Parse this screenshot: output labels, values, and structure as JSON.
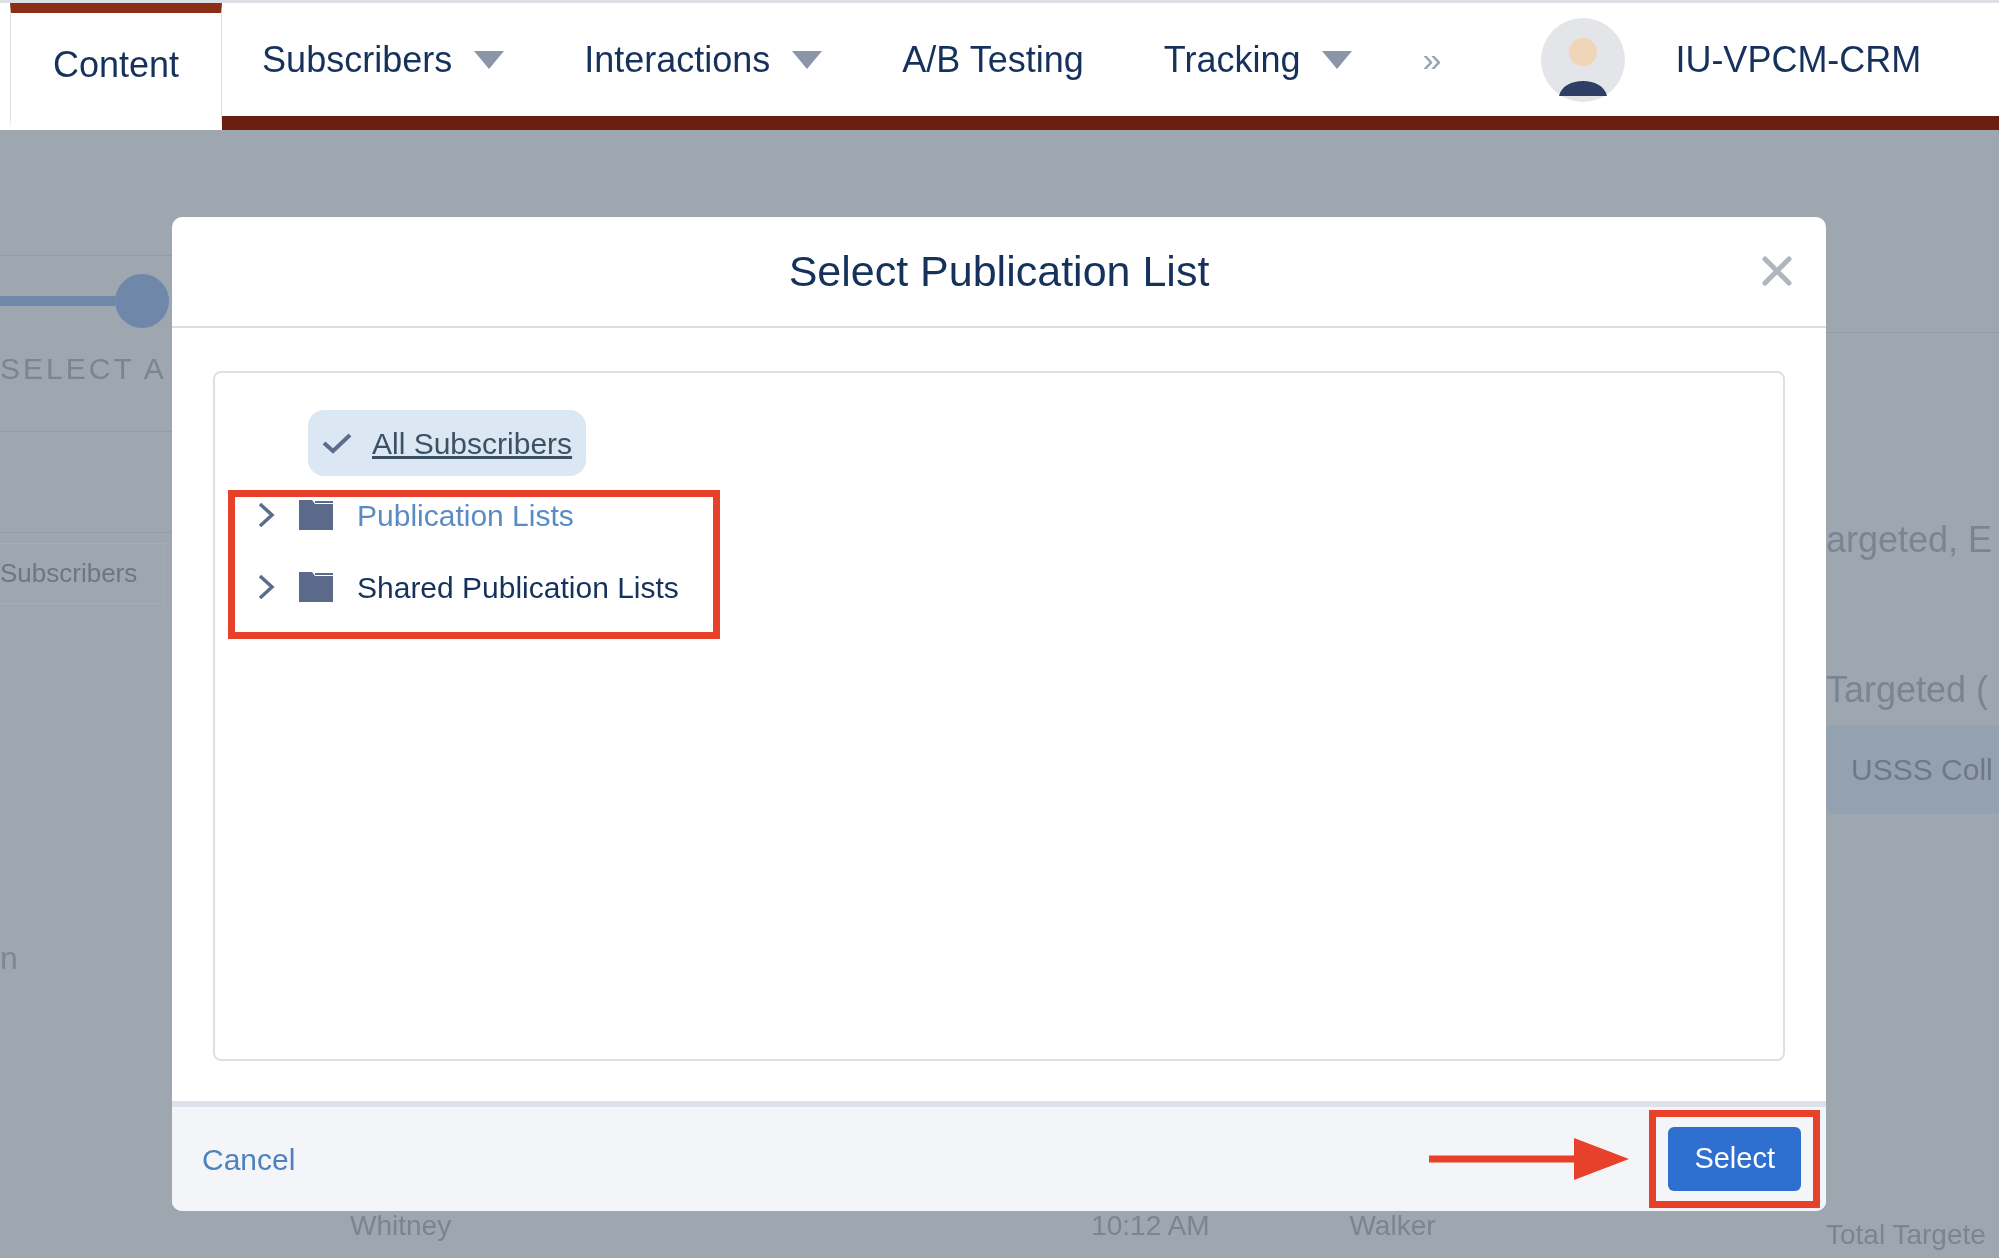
{
  "nav": {
    "tabs": [
      {
        "label": "Content",
        "selected": true,
        "dropdown": false
      },
      {
        "label": "Subscribers",
        "selected": false,
        "dropdown": true
      },
      {
        "label": "Interactions",
        "selected": false,
        "dropdown": true
      },
      {
        "label": "A/B Testing",
        "selected": false,
        "dropdown": false
      },
      {
        "label": "Tracking",
        "selected": false,
        "dropdown": true
      }
    ],
    "more": "»",
    "account": "IU-VPCM-CRM"
  },
  "background": {
    "step_label": "SELECT A",
    "search_placeholder": "Subscribers",
    "left_text": "n",
    "right_texts": [
      "argeted, E",
      "Targeted ("
    ],
    "chip": "USSS Coll",
    "total_label": "Total Targete",
    "row": [
      "Whitney",
      "10:12 AM",
      "Walker"
    ]
  },
  "dialog": {
    "title": "Select Publication List",
    "tree": [
      {
        "label": "All Subscribers",
        "kind": "item",
        "selected": true
      },
      {
        "label": "Publication Lists",
        "kind": "folder",
        "selected": false,
        "hovered": true
      },
      {
        "label": "Shared Publication Lists",
        "kind": "folder",
        "selected": false,
        "hovered": false
      }
    ],
    "cancel": "Cancel",
    "confirm": "Select"
  }
}
